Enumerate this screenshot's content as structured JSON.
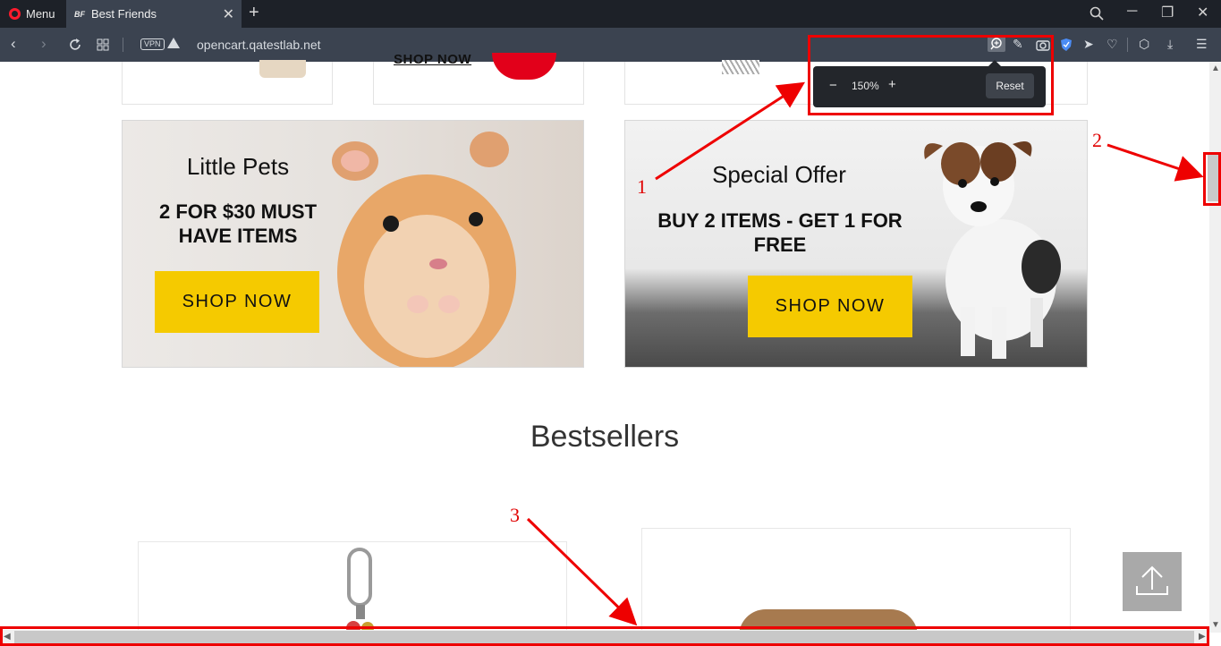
{
  "browser": {
    "menu_label": "Menu",
    "tab": {
      "favicon": "BF",
      "title": "Best Friends",
      "close": "✕"
    },
    "new_tab": "+",
    "url": "opencart.qatestlab.net",
    "vpn_badge": "VPN",
    "window_controls": {
      "search": "search-icon",
      "minimize": "─",
      "restore": "❐",
      "close": "✕"
    }
  },
  "zoom_popup": {
    "minus": "−",
    "value": "150%",
    "plus": "+",
    "reset_label": "Reset"
  },
  "page": {
    "partial_link": "SHOP NOW",
    "banners": [
      {
        "title": "Little Pets",
        "subtitle": "2 FOR $30 MUST HAVE ITEMS",
        "button": "SHOP NOW"
      },
      {
        "title": "Special Offer",
        "subtitle": "BUY 2 ITEMS - GET 1 FOR FREE",
        "button": "SHOP NOW"
      }
    ],
    "section_title": "Bestsellers"
  },
  "annotations": [
    {
      "label": "1"
    },
    {
      "label": "2"
    },
    {
      "label": "3"
    }
  ],
  "colors": {
    "accent_button": "#f5ca00",
    "annotation_red": "#ee0000",
    "chrome_dark": "#1d2128",
    "chrome_bar": "#3b4350"
  }
}
